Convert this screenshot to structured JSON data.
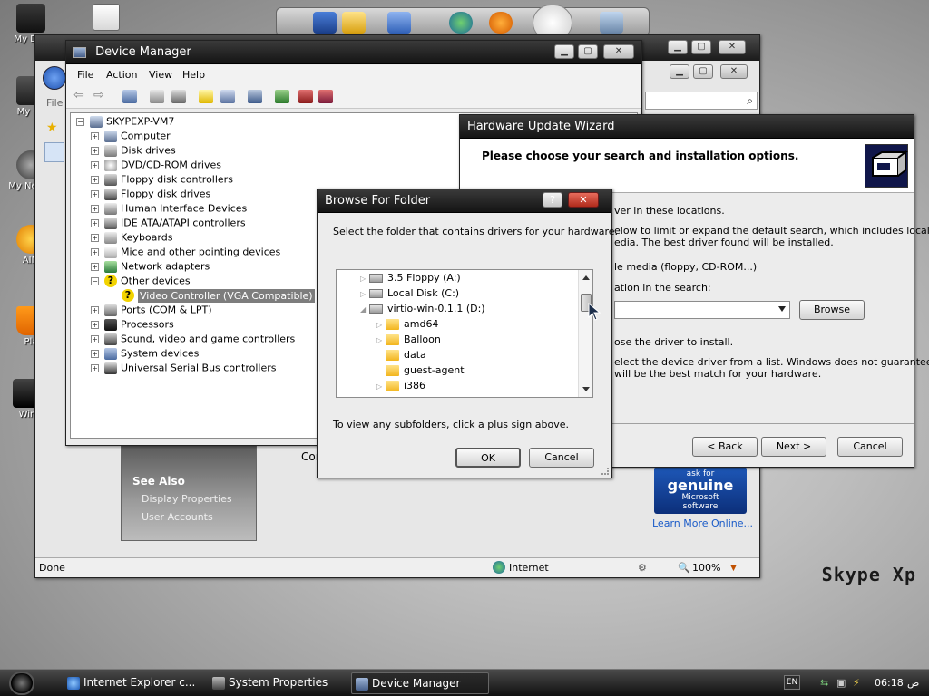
{
  "colors": {
    "titlebar_dark": "#1b1b1b",
    "selection_gray": "#7d7d7d",
    "close_red": "#c0392b",
    "link_blue": "#1a5bc8"
  },
  "desktop": {
    "icons": [
      {
        "label": "My Doc",
        "icon": "documents-icon"
      },
      {
        "label": "My Co",
        "icon": "computer-icon"
      },
      {
        "label": "My Ne Pla",
        "icon": "network-icon"
      },
      {
        "label": "AIM",
        "icon": "aim-icon"
      },
      {
        "label": "Pla",
        "icon": "vlc-icon"
      },
      {
        "label": "Win",
        "icon": "app-icon"
      }
    ],
    "watermark": "Skype Xp"
  },
  "ie_window": {
    "address_partial": "File",
    "status_done": "Done",
    "zone": "Internet",
    "zoom": "100%",
    "see_also": {
      "title": "See Also",
      "links": [
        "Display Properties",
        "User Accounts"
      ]
    },
    "partial_text": "Con",
    "genuine": {
      "line1": "ask for",
      "line2": "genuine",
      "line3": "Microsoft",
      "line4": "software"
    },
    "learn_more": "Learn More Online..."
  },
  "device_manager": {
    "title": "Device Manager",
    "menu": [
      "File",
      "Action",
      "View",
      "Help"
    ],
    "root": "SKYPEXP-VM7",
    "tree": [
      {
        "label": "Computer",
        "icon": "computer-icon",
        "expanded": false
      },
      {
        "label": "Disk drives",
        "icon": "disk-drive-icon",
        "expanded": false
      },
      {
        "label": "DVD/CD-ROM drives",
        "icon": "cdrom-icon",
        "expanded": false
      },
      {
        "label": "Floppy disk controllers",
        "icon": "controller-icon",
        "expanded": false
      },
      {
        "label": "Floppy disk drives",
        "icon": "floppy-icon",
        "expanded": false
      },
      {
        "label": "Human Interface Devices",
        "icon": "hid-icon",
        "expanded": false
      },
      {
        "label": "IDE ATA/ATAPI controllers",
        "icon": "ide-icon",
        "expanded": false
      },
      {
        "label": "Keyboards",
        "icon": "keyboard-icon",
        "expanded": false
      },
      {
        "label": "Mice and other pointing devices",
        "icon": "mouse-icon",
        "expanded": false
      },
      {
        "label": "Network adapters",
        "icon": "network-adapter-icon",
        "expanded": false
      },
      {
        "label": "Other devices",
        "icon": "warning-icon",
        "expanded": true
      },
      {
        "label": "Video Controller (VGA Compatible)",
        "icon": "warning-icon",
        "child": true,
        "selected": true
      },
      {
        "label": "Ports (COM & LPT)",
        "icon": "port-icon",
        "expanded": false
      },
      {
        "label": "Processors",
        "icon": "processor-icon",
        "expanded": false
      },
      {
        "label": "Sound, video and game controllers",
        "icon": "sound-icon",
        "expanded": false
      },
      {
        "label": "System devices",
        "icon": "system-icon",
        "expanded": false
      },
      {
        "label": "Universal Serial Bus controllers",
        "icon": "usb-icon",
        "expanded": false
      }
    ]
  },
  "wizard": {
    "title": "Hardware Update Wizard",
    "header": "Please choose your search and installation options.",
    "lines": [
      "ver in these locations.",
      "elow to limit or expand the default search, which includes local",
      "edia. The best driver found will be installed.",
      "le media (floppy, CD-ROM...)",
      "ation in the search:",
      "ose the driver to install.",
      "elect the device driver from a list.  Windows does not guarantee that",
      "will be the best match for your hardware."
    ],
    "browse_button": "Browse",
    "back_button": "< Back",
    "next_button": "Next >",
    "cancel_button": "Cancel"
  },
  "browse_folder": {
    "title": "Browse For Folder",
    "help_glyph": "?",
    "instruction": "Select the folder that contains drivers for your hardware.",
    "folders": [
      {
        "label": "3.5 Floppy (A:)",
        "icon": "floppy-drive-icon",
        "level": 0
      },
      {
        "label": "Local Disk (C:)",
        "icon": "hard-disk-icon",
        "level": 0
      },
      {
        "label": "virtio-win-0.1.1 (D:)",
        "icon": "cd-drive-icon",
        "level": 0
      },
      {
        "label": "amd64",
        "icon": "folder-icon",
        "level": 1
      },
      {
        "label": "Balloon",
        "icon": "folder-icon",
        "level": 1
      },
      {
        "label": "data",
        "icon": "folder-icon",
        "level": 1
      },
      {
        "label": "guest-agent",
        "icon": "folder-icon",
        "level": 1
      },
      {
        "label": "i386",
        "icon": "folder-icon",
        "level": 1
      }
    ],
    "hint": "To view any subfolders, click a plus sign above.",
    "ok_button": "OK",
    "cancel_button": "Cancel"
  },
  "taskbar": {
    "tasks": [
      {
        "label": "Internet Explorer c...",
        "icon": "ie-icon"
      },
      {
        "label": "System Properties",
        "icon": "system-properties-icon"
      },
      {
        "label": "Device Manager",
        "icon": "device-manager-icon",
        "active": true
      }
    ],
    "language": "EN",
    "clock": "06:18",
    "ampm": "ص"
  }
}
